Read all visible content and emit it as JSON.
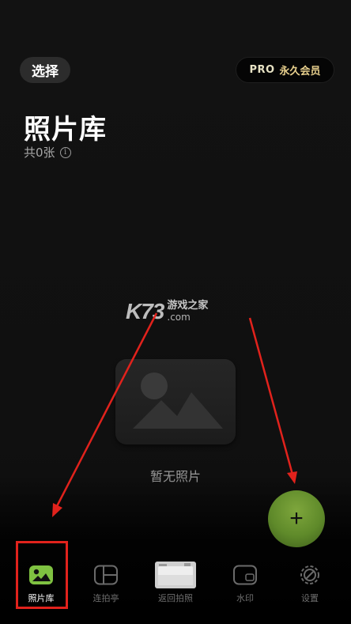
{
  "header": {
    "select_label": "选择",
    "pro_label": "PRO",
    "member_label": "永久会员"
  },
  "library": {
    "title": "照片库",
    "count_text": "共0张",
    "info_icon": "i"
  },
  "watermark": {
    "brand": "K73",
    "site_cn": "游戏之家",
    "site_com": ".com"
  },
  "empty_state": {
    "message": "暂无照片"
  },
  "fab": {
    "symbol": "+"
  },
  "tabs": [
    {
      "label": "照片库",
      "icon": "photo-library-icon",
      "active": true
    },
    {
      "label": "连拍亭",
      "icon": "burst-booth-icon",
      "active": false
    },
    {
      "label": "返回拍照",
      "icon": "camera-return-icon",
      "active": false
    },
    {
      "label": "水印",
      "icon": "watermark-icon",
      "active": false
    },
    {
      "label": "设置",
      "icon": "settings-icon",
      "active": false
    }
  ],
  "colors": {
    "accent_green": "#6c9a2e",
    "annotation_red": "#e1221c",
    "pro_gold": "#e7cf8c"
  }
}
